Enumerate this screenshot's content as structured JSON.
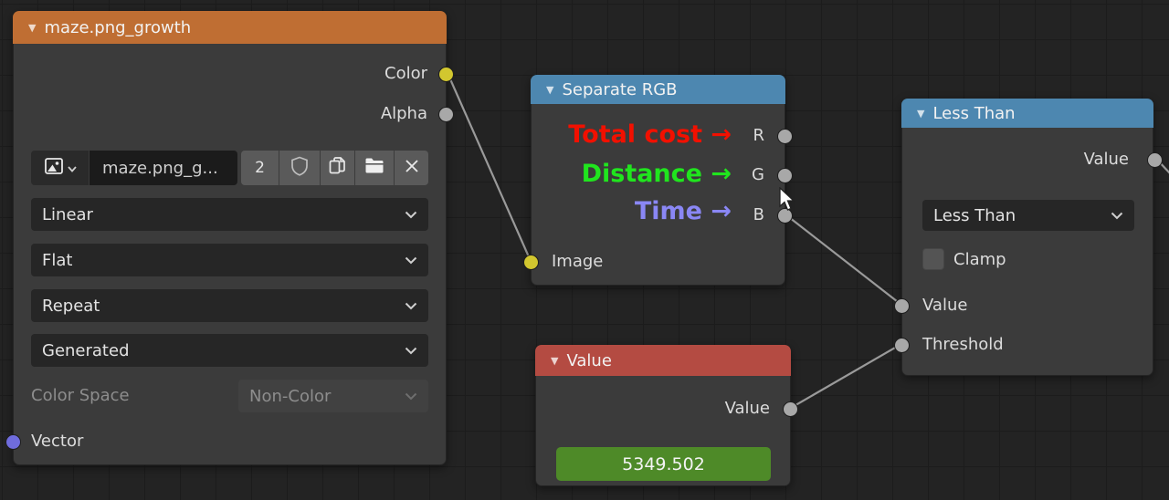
{
  "editor": {
    "name": "Shader Node Editor"
  },
  "colors": {
    "canvas_bg": "#232323",
    "grid_line": "#1c1c1c",
    "node_body": "#3b3b3b",
    "header_texture": "#bf6e33",
    "header_converter": "#4d87b0",
    "header_input": "#b44b42",
    "socket_yellow": "#d2c72f",
    "socket_gray": "#a8a8a8",
    "socket_vector": "#6f6cdd",
    "wire": "#9a9a9a",
    "value_field_green": "#4e8a28"
  },
  "nodes": {
    "image": {
      "title": "maze.png_growth",
      "out_color": "Color",
      "out_alpha": "Alpha",
      "datablock": {
        "name": "maze.png_g...",
        "users": "2"
      },
      "interpolation": "Linear",
      "projection": "Flat",
      "extension": "Repeat",
      "source": "Generated",
      "color_space_label": "Color Space",
      "color_space_value": "Non-Color",
      "in_vector": "Vector"
    },
    "separate_rgb": {
      "title": "Separate RGB",
      "out_r": "R",
      "out_g": "G",
      "out_b": "B",
      "in_image": "Image",
      "annotations": [
        {
          "text": "Total cost →",
          "color": "#f21000"
        },
        {
          "text": "Distance →",
          "color": "#20e51e"
        },
        {
          "text": "Time →",
          "color": "#8a87f5"
        }
      ]
    },
    "less_than": {
      "title": "Less Than",
      "out_value": "Value",
      "operation": "Less Than",
      "clamp_label": "Clamp",
      "in_value": "Value",
      "in_threshold": "Threshold"
    },
    "value": {
      "title": "Value",
      "out_value": "Value",
      "number": "5349.502"
    }
  }
}
